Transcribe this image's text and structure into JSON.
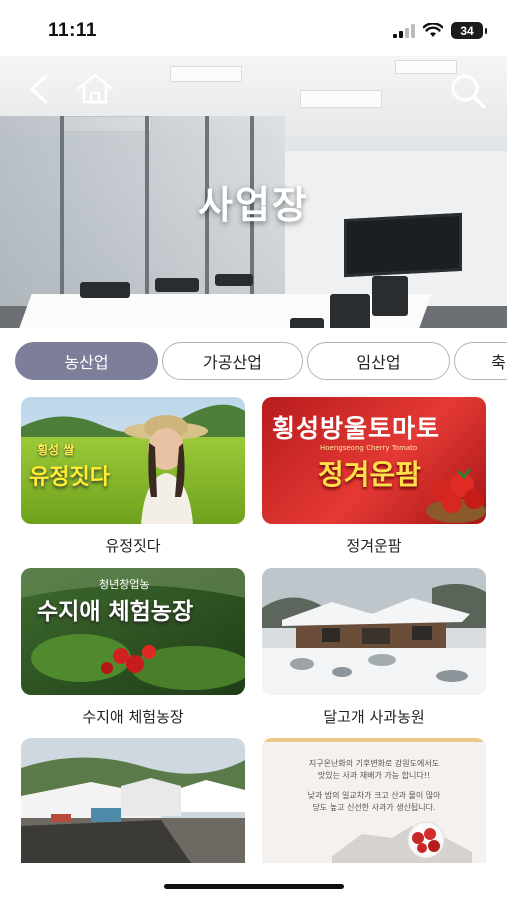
{
  "status_bar": {
    "time": "11:11",
    "battery": "34"
  },
  "hero": {
    "title": "사업장"
  },
  "tabs": [
    {
      "label": "농산업",
      "active": true
    },
    {
      "label": "가공산업",
      "active": false
    },
    {
      "label": "임산업",
      "active": false
    },
    {
      "label": "축",
      "active": false
    }
  ],
  "cards": [
    {
      "label": "유정짓다",
      "overlay_small": "횡성 쌀",
      "overlay_big": "유정짓다"
    },
    {
      "label": "정겨운팜",
      "overlay_top": "횡성방울토마토",
      "overlay_sub": "Hoengseong Cherry Tomato",
      "overlay_big": "정겨운팜"
    },
    {
      "label": "수지애 체험농장",
      "overlay_small": "청년창업농",
      "overlay_big": "수지애 체험농장"
    },
    {
      "label": "달고개 사과농원"
    },
    {
      "label": ""
    },
    {
      "label": "",
      "overlay_line1": "지구온난화의 기후변화로 강원도에서도",
      "overlay_line2": "맛있는 사과 재배가 가능 합니다!!",
      "overlay_line3": "낮과 밤의 일교차가 크고 산과 물이 많아",
      "overlay_line4": "당도 높고 신선한 사과가 생산됩니다."
    }
  ]
}
